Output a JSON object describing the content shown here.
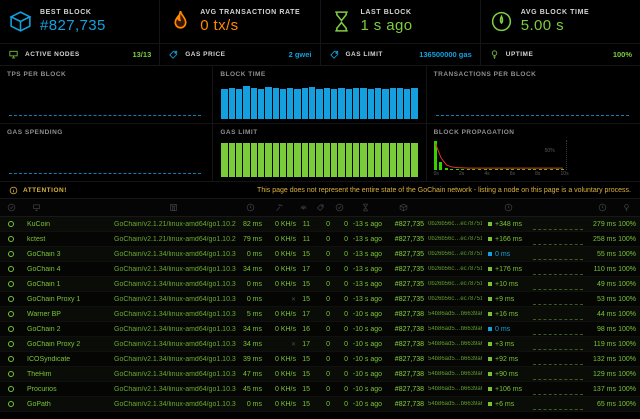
{
  "colors": {
    "blue": "#14a0de",
    "green": "#7dcc3f",
    "orange": "#ff8a00",
    "yellow": "#dcb33c",
    "bar_blue": "#14a0de",
    "bar_green": "#7bcc3a",
    "prop_green": "#3ad000",
    "prop_red": "#e3342f"
  },
  "icons": {
    "best_block": "cube-icon",
    "avg_tx_rate": "flame-icon",
    "last_block": "hourglass-icon",
    "avg_block_time": "gauge-icon",
    "active_nodes": "monitor-icon",
    "gas_price": "tag-icon",
    "gas_limit": "tag-icon",
    "uptime": "lightbulb-icon",
    "attention": "info-circle-icon",
    "table_columns": [
      "check-circle-icon",
      "monitor-icon",
      "server-icon",
      "clock-icon",
      "pickaxe-icon",
      "signal-icon",
      "tag-icon",
      "check-circle-icon",
      "hourglass-icon",
      "cube-icon",
      "",
      "clock-icon",
      "",
      "clock-icon",
      "lightbulb-icon"
    ]
  },
  "topStats": {
    "best_block": {
      "label": "BEST BLOCK",
      "value": "#827,735"
    },
    "avg_tx_rate": {
      "label": "AVG TRANSACTION RATE",
      "value": "0 tx/s"
    },
    "last_block": {
      "label": "LAST BLOCK",
      "value": "1 s ago"
    },
    "avg_block_time": {
      "label": "AVG BLOCK TIME",
      "value": "5.00 s"
    }
  },
  "subStats": {
    "active_nodes": {
      "label": "ACTIVE NODES",
      "value": "13/13"
    },
    "gas_price": {
      "label": "GAS PRICE",
      "value": "2 gwei"
    },
    "gas_limit": {
      "label": "GAS LIMIT",
      "value": "136500000 gas"
    },
    "uptime": {
      "label": "UPTIME",
      "value": "100%"
    }
  },
  "attention": {
    "label": "ATTENTION!",
    "message": "This page does not represent the entire state of the GoChain network - listing a node on this page is a voluntary process."
  },
  "chart_data": [
    {
      "type": "line",
      "title": "TPS PER BLOCK",
      "values": [
        0,
        0,
        0,
        0,
        0,
        0,
        0,
        0,
        0,
        0,
        0,
        0,
        0,
        0,
        0,
        0,
        0,
        0,
        0,
        0,
        0,
        0,
        0,
        0,
        0,
        0,
        0
      ],
      "ylim": [
        0,
        1
      ],
      "style": "dashed-flat-baseline"
    },
    {
      "type": "bar",
      "title": "BLOCK TIME",
      "unit": "s",
      "ylim": [
        0,
        6
      ],
      "values": [
        5.0,
        5.1,
        5.0,
        5.6,
        5.2,
        5.0,
        5.3,
        5.1,
        5.0,
        5.2,
        5.0,
        5.1,
        5.3,
        5.0,
        5.1,
        5.0,
        5.2,
        5.0,
        5.1,
        5.2,
        5.0,
        5.1,
        5.0,
        5.2,
        5.1,
        5.0,
        5.1
      ]
    },
    {
      "type": "line",
      "title": "TRANSACTIONS PER BLOCK",
      "values": [
        0,
        0,
        0,
        0,
        0,
        0,
        0,
        0,
        0,
        0,
        0,
        0,
        0,
        0,
        0,
        0,
        0,
        0,
        0,
        0,
        0,
        0,
        0,
        0,
        0,
        0,
        0
      ],
      "ylim": [
        0,
        1
      ],
      "style": "dashed-flat-baseline"
    },
    {
      "type": "line",
      "title": "GAS SPENDING",
      "values": [
        0,
        0,
        0,
        0,
        0,
        0,
        0,
        0,
        0,
        0,
        0,
        0,
        0,
        0,
        0,
        0,
        0,
        0,
        0,
        0,
        0,
        0,
        0,
        0,
        0,
        0,
        0
      ],
      "ylim": [
        0,
        1
      ],
      "style": "dashed-flat-baseline"
    },
    {
      "type": "bar",
      "title": "GAS LIMIT",
      "unit": "gas",
      "ylim": [
        0,
        143000000
      ],
      "values": [
        136500000,
        136500000,
        136500000,
        136500000,
        136500000,
        136500000,
        136500000,
        136500000,
        136500000,
        136500000,
        136500000,
        136500000,
        136500000,
        136500000,
        136500000,
        136500000,
        136500000,
        136500000,
        136500000,
        136500000,
        136500000,
        136500000,
        136500000,
        136500000,
        136500000,
        136500000,
        136500000
      ]
    },
    {
      "type": "histogram",
      "title": "BLOCK PROPAGATION",
      "x_ticks": [
        "0s",
        "2s",
        "4s",
        "6s",
        "8s",
        "10s"
      ],
      "y_tick": "50%",
      "bar_values_pct": [
        97,
        27,
        6,
        3,
        2,
        2,
        1,
        1,
        1,
        1,
        1,
        1,
        1,
        1,
        1,
        1,
        1,
        1,
        1,
        1,
        1,
        1,
        1,
        1
      ],
      "line_values_pct": [
        90,
        40,
        14,
        7,
        5,
        4,
        3,
        3,
        3,
        3,
        3,
        3,
        3,
        3,
        3,
        3,
        3,
        3,
        3,
        3,
        3,
        3,
        3,
        3
      ]
    }
  ],
  "table": {
    "rows": [
      {
        "name": "KuCoin",
        "type": "GoChain/v2.1.21/linux-amd64/go1.10.2",
        "latency": "82 ms",
        "mining": "0 KH/s",
        "peers": "11",
        "pending": "0",
        "uncles": "0",
        "last_block": "-13 s ago",
        "block": "#827,735",
        "hash": "0b26b56c…ec787515",
        "prop": "+348 ms",
        "prop_color": "green",
        "avg": "279 ms",
        "uptime": "100%"
      },
      {
        "name": "kctest",
        "type": "GoChain/v2.1.21/linux-amd64/go1.10.2",
        "latency": "79 ms",
        "mining": "0 KH/s",
        "peers": "11",
        "pending": "0",
        "uncles": "0",
        "last_block": "-13 s ago",
        "block": "#827,735",
        "hash": "0b26b56c…ec787515",
        "prop": "+166 ms",
        "prop_color": "green",
        "avg": "258 ms",
        "uptime": "100%"
      },
      {
        "name": "GoChain 3",
        "type": "GoChain/v2.1.34/linux-amd64/go1.10.3",
        "latency": "0 ms",
        "mining": "0 KH/s",
        "peers": "15",
        "pending": "0",
        "uncles": "0",
        "last_block": "-13 s ago",
        "block": "#827,735",
        "hash": "0b26b56c…ec787515",
        "prop": "0 ms",
        "prop_color": "blue",
        "avg": "55 ms",
        "uptime": "100%"
      },
      {
        "name": "GoChain 4",
        "type": "GoChain/v2.1.34/linux-amd64/go1.10.3",
        "latency": "34 ms",
        "mining": "0 KH/s",
        "peers": "17",
        "pending": "0",
        "uncles": "0",
        "last_block": "-13 s ago",
        "block": "#827,735",
        "hash": "0b26b56c…ec787515",
        "prop": "+176 ms",
        "prop_color": "green",
        "avg": "110 ms",
        "uptime": "100%"
      },
      {
        "name": "GoChain 1",
        "type": "GoChain/v2.1.34/linux-amd64/go1.10.3",
        "latency": "0 ms",
        "mining": "0 KH/s",
        "peers": "15",
        "pending": "0",
        "uncles": "0",
        "last_block": "-13 s ago",
        "block": "#827,735",
        "hash": "0b26b56c…ec787515",
        "prop": "+10 ms",
        "prop_color": "green",
        "avg": "49 ms",
        "uptime": "100%"
      },
      {
        "name": "GoChain Proxy 1",
        "type": "GoChain/v2.1.34/linux-amd64/go1.10.3",
        "latency": "0 ms",
        "mining": null,
        "peers": "15",
        "pending": "0",
        "uncles": "0",
        "last_block": "-13 s ago",
        "block": "#827,735",
        "hash": "0b26b56c…ec787515",
        "prop": "+9 ms",
        "prop_color": "green",
        "avg": "53 ms",
        "uptime": "100%"
      },
      {
        "name": "Warner BP",
        "type": "GoChain/v2.1.34/linux-amd64/go1.10.3",
        "latency": "5 ms",
        "mining": "0 KH/s",
        "peers": "17",
        "pending": "0",
        "uncles": "0",
        "last_block": "-10 s ago",
        "block": "#827,738",
        "hash": "54b86ad5…b6639a67",
        "prop": "+16 ms",
        "prop_color": "green",
        "avg": "44 ms",
        "uptime": "100%"
      },
      {
        "name": "GoChain 2",
        "type": "GoChain/v2.1.34/linux-amd64/go1.10.3",
        "latency": "34 ms",
        "mining": "0 KH/s",
        "peers": "16",
        "pending": "0",
        "uncles": "0",
        "last_block": "-10 s ago",
        "block": "#827,738",
        "hash": "54b86ad5…b6639a67",
        "prop": "0 ms",
        "prop_color": "blue",
        "avg": "98 ms",
        "uptime": "100%"
      },
      {
        "name": "GoChain Proxy 2",
        "type": "GoChain/v2.1.34/linux-amd64/go1.10.3",
        "latency": "34 ms",
        "mining": null,
        "peers": "17",
        "pending": "0",
        "uncles": "0",
        "last_block": "-10 s ago",
        "block": "#827,738",
        "hash": "54b86ad5…b6639a67",
        "prop": "+3 ms",
        "prop_color": "green",
        "avg": "119 ms",
        "uptime": "100%"
      },
      {
        "name": "ICOSyndicate",
        "type": "GoChain/v2.1.34/linux-amd64/go1.10.3",
        "latency": "39 ms",
        "mining": "0 KH/s",
        "peers": "15",
        "pending": "0",
        "uncles": "0",
        "last_block": "-10 s ago",
        "block": "#827,738",
        "hash": "54b86ad5…b6639a67",
        "prop": "+92 ms",
        "prop_color": "green",
        "avg": "132 ms",
        "uptime": "100%"
      },
      {
        "name": "TheHim",
        "type": "GoChain/v2.1.34/linux-amd64/go1.10.3",
        "latency": "47 ms",
        "mining": "0 KH/s",
        "peers": "15",
        "pending": "0",
        "uncles": "0",
        "last_block": "-10 s ago",
        "block": "#827,738",
        "hash": "54b86ad5…b6639a67",
        "prop": "+90 ms",
        "prop_color": "green",
        "avg": "129 ms",
        "uptime": "100%"
      },
      {
        "name": "Procurios",
        "type": "GoChain/v2.1.34/linux-amd64/go1.10.3",
        "latency": "45 ms",
        "mining": "0 KH/s",
        "peers": "15",
        "pending": "0",
        "uncles": "0",
        "last_block": "-10 s ago",
        "block": "#827,738",
        "hash": "54b86ad5…b6639a67",
        "prop": "+106 ms",
        "prop_color": "green",
        "avg": "137 ms",
        "uptime": "100%"
      },
      {
        "name": "GoPath",
        "type": "GoChain/v2.1.34/linux-amd64/go1.10.3",
        "latency": "0 ms",
        "mining": "0 KH/s",
        "peers": "15",
        "pending": "0",
        "uncles": "0",
        "last_block": "-10 s ago",
        "block": "#827,738",
        "hash": "54b86ad5…b6639a67",
        "prop": "+6 ms",
        "prop_color": "green",
        "avg": "65 ms",
        "uptime": "100%"
      }
    ]
  }
}
